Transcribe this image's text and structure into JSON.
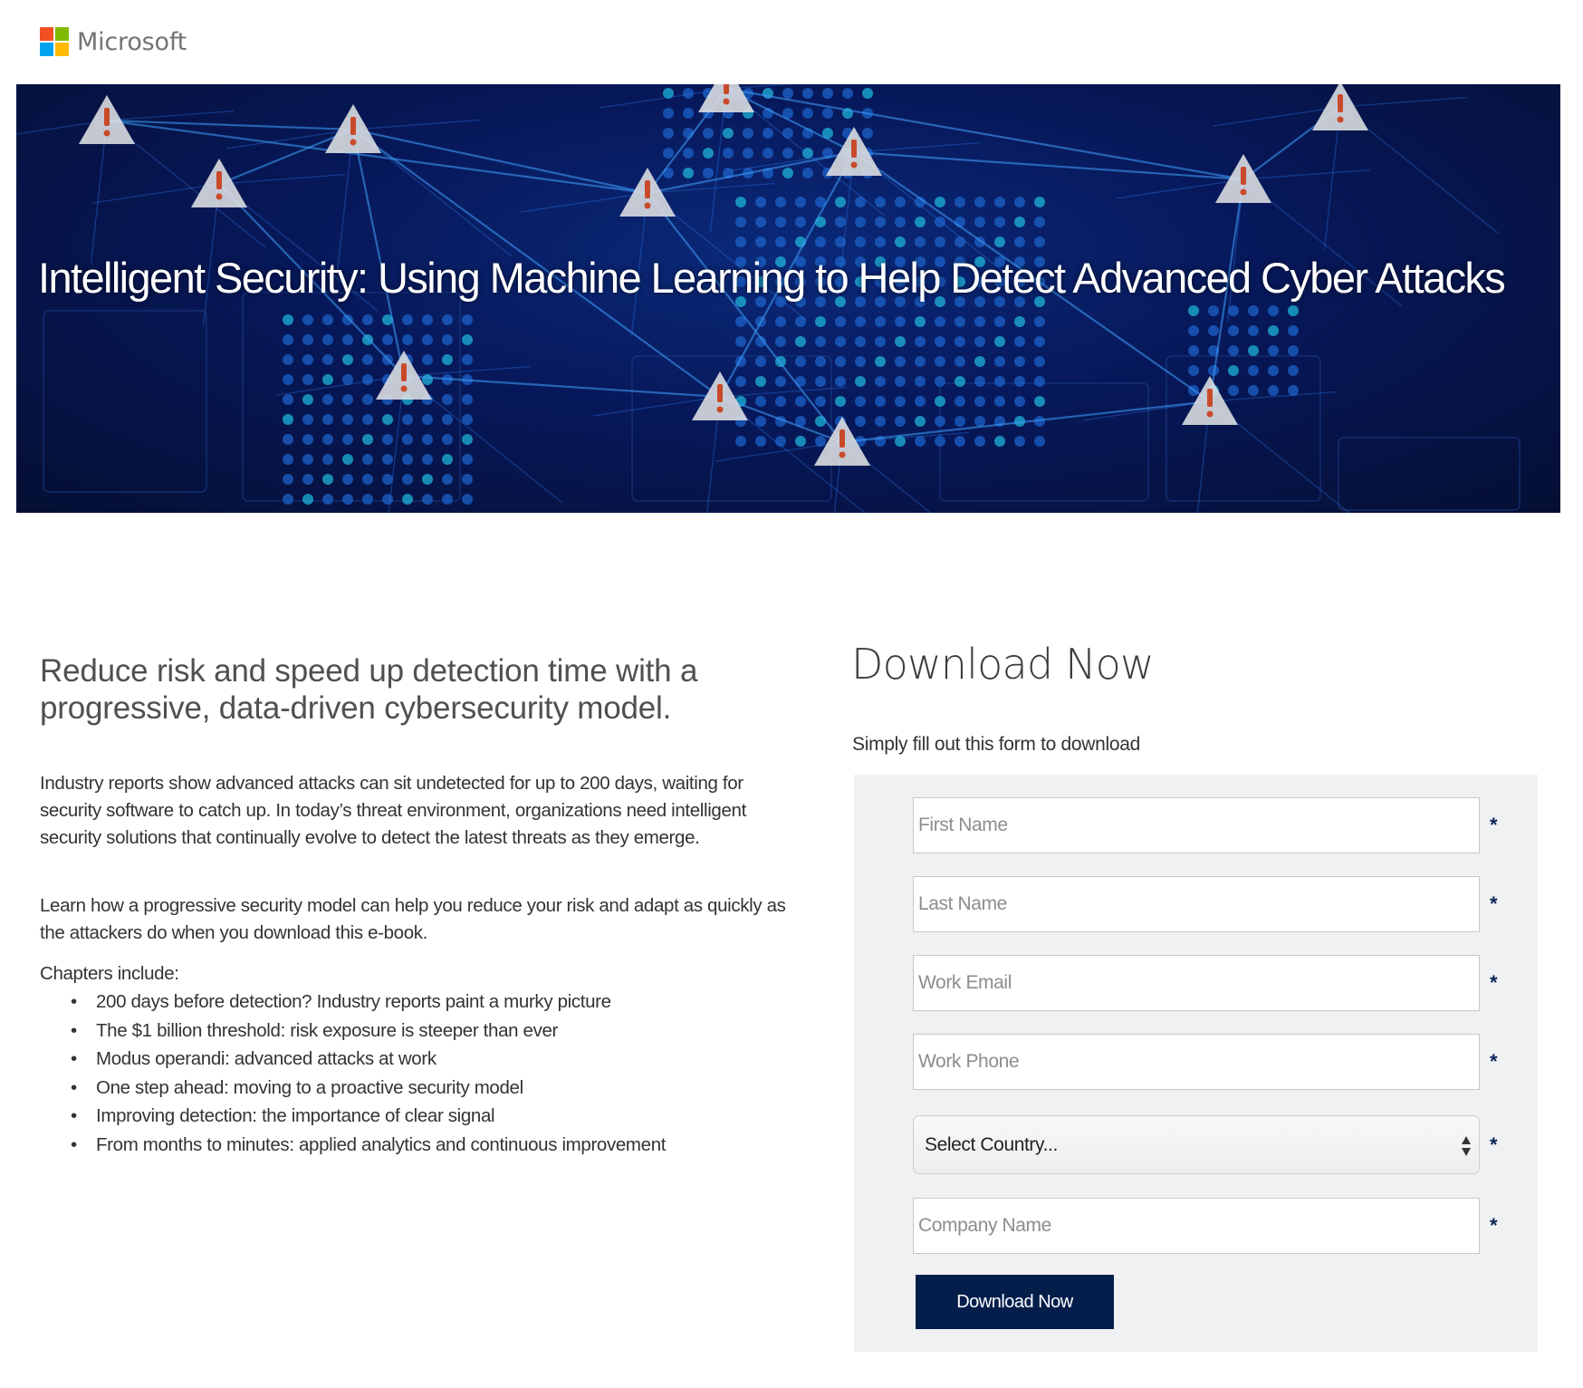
{
  "brand": {
    "name": "Microsoft",
    "logo_colors": [
      "#f25022",
      "#7fba00",
      "#00a4ef",
      "#ffb900"
    ]
  },
  "hero": {
    "title": "Intelligent Security: Using Machine Learning to Help Detect Advanced Cyber Attacks",
    "image_description": "world map network with warning triangles",
    "alert_icon_count": 12
  },
  "intro": {
    "headline": "Reduce risk and speed up detection time with a progressive, data-driven cybersecurity model.",
    "paragraphs": [
      "Industry reports show advanced attacks can sit undetected for up to 200 days, waiting for security software to catch up. In today’s threat environment, organizations need intelligent security solutions that continually evolve to detect the latest threats as they emerge.",
      "Learn how a progressive security model can help you reduce your risk and adapt as quickly as the attackers do when you download this e-book."
    ],
    "chapters_label": "Chapters include:",
    "chapters": [
      "200 days before detection? Industry reports paint a murky picture",
      "The $1 billion threshold: risk exposure is steeper than ever",
      "Modus operandi: advanced attacks at work",
      "One step ahead: moving to a proactive security model",
      "Improving detection: the importance of clear signal",
      "From months to minutes: applied analytics and continuous improvement"
    ]
  },
  "form": {
    "title": "Download Now",
    "subtitle": "Simply fill out this form to download",
    "required_marker": "*",
    "fields": [
      {
        "placeholder": "First Name",
        "value": ""
      },
      {
        "placeholder": "Last Name",
        "value": ""
      },
      {
        "placeholder": "Work Email",
        "value": ""
      },
      {
        "placeholder": "Work Phone",
        "value": ""
      }
    ],
    "country_select": {
      "selected": "Select Country..."
    },
    "company_field": {
      "placeholder": "Company Name",
      "value": ""
    },
    "submit_label": "Download Now",
    "colors": {
      "panel": "#f0f1f3",
      "button": "#041e4b",
      "required": "#0a2458"
    }
  }
}
